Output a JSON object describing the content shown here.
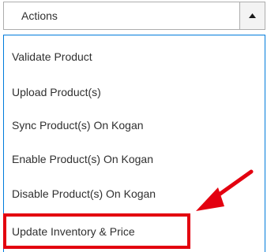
{
  "select": {
    "label": "Actions",
    "arrow_icon": "triangle-up-icon"
  },
  "menu": {
    "items": [
      {
        "label": "Validate Product"
      },
      {
        "label": "Upload Product(s)"
      },
      {
        "label": "Sync Product(s) On Kogan"
      },
      {
        "label": "Enable Product(s) On Kogan"
      },
      {
        "label": "Disable Product(s) On Kogan"
      },
      {
        "label": "Update Inventory & Price"
      }
    ]
  },
  "annotation": {
    "highlight_color": "#e3000f",
    "arrow_color": "#e3000f",
    "arrow_icon": "red-arrow-icon"
  },
  "colors": {
    "menu_border": "#007bdb",
    "select_border": "#adadad",
    "text": "#303030"
  }
}
